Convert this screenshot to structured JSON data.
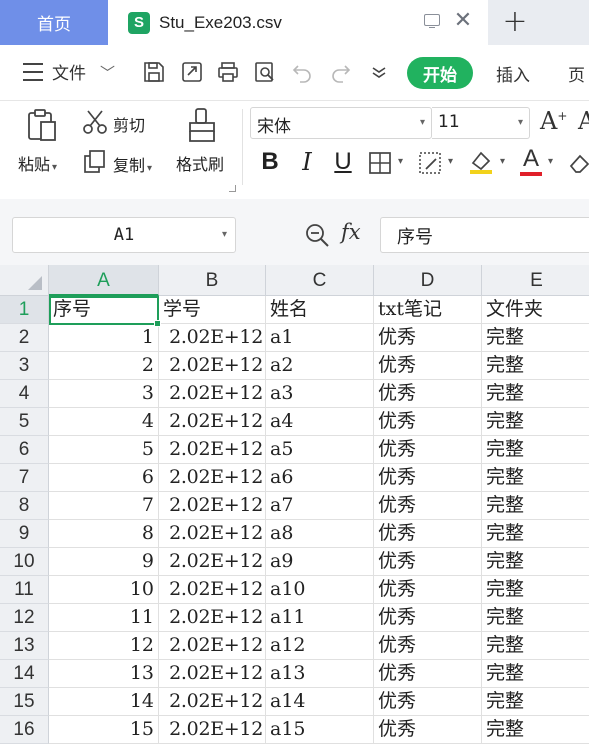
{
  "tabs": {
    "home_label": "首页",
    "file_logo": "S",
    "file_name": "Stu_Exe203.csv",
    "close_glyph": "✕",
    "add_glyph": "+"
  },
  "menu": {
    "file_label": "文件",
    "file_caret": "﹀",
    "start_label": "开始",
    "insert_label": "插入",
    "page_label": "页"
  },
  "ribbon": {
    "paste_label": "粘贴",
    "cut_label": "剪切",
    "copy_label": "复制",
    "format_painter_label": "格式刷",
    "font_name": "宋体",
    "font_size": "11",
    "bold_glyph": "B",
    "italic_glyph": "I",
    "underline_glyph": "U",
    "font_color_glyph": "A",
    "font_color": "#e0202a",
    "highlight_color": "#f2d21b",
    "grow_font_glyph": "A",
    "caret": "▾"
  },
  "formula_bar": {
    "name_box": "A1",
    "fx_label": "fx",
    "formula_value": "序号"
  },
  "sheet": {
    "columns": [
      "A",
      "B",
      "C",
      "D",
      "E"
    ],
    "header_row": [
      "序号",
      "学号",
      "姓名",
      "txt笔记",
      "文件夹"
    ],
    "rows": [
      {
        "row_num": "1"
      },
      {
        "row_num": "2",
        "a": "1",
        "b": "2.02E+12",
        "c": "a1",
        "d": "优秀",
        "e": "完整"
      },
      {
        "row_num": "3",
        "a": "2",
        "b": "2.02E+12",
        "c": "a2",
        "d": "优秀",
        "e": "完整"
      },
      {
        "row_num": "4",
        "a": "3",
        "b": "2.02E+12",
        "c": "a3",
        "d": "优秀",
        "e": "完整"
      },
      {
        "row_num": "5",
        "a": "4",
        "b": "2.02E+12",
        "c": "a4",
        "d": "优秀",
        "e": "完整"
      },
      {
        "row_num": "6",
        "a": "5",
        "b": "2.02E+12",
        "c": "a5",
        "d": "优秀",
        "e": "完整"
      },
      {
        "row_num": "7",
        "a": "6",
        "b": "2.02E+12",
        "c": "a6",
        "d": "优秀",
        "e": "完整"
      },
      {
        "row_num": "8",
        "a": "7",
        "b": "2.02E+12",
        "c": "a7",
        "d": "优秀",
        "e": "完整"
      },
      {
        "row_num": "9",
        "a": "8",
        "b": "2.02E+12",
        "c": "a8",
        "d": "优秀",
        "e": "完整"
      },
      {
        "row_num": "10",
        "a": "9",
        "b": "2.02E+12",
        "c": "a9",
        "d": "优秀",
        "e": "完整"
      },
      {
        "row_num": "11",
        "a": "10",
        "b": "2.02E+12",
        "c": "a10",
        "d": "优秀",
        "e": "完整"
      },
      {
        "row_num": "12",
        "a": "11",
        "b": "2.02E+12",
        "c": "a11",
        "d": "优秀",
        "e": "完整"
      },
      {
        "row_num": "13",
        "a": "12",
        "b": "2.02E+12",
        "c": "a12",
        "d": "优秀",
        "e": "完整"
      },
      {
        "row_num": "14",
        "a": "13",
        "b": "2.02E+12",
        "c": "a13",
        "d": "优秀",
        "e": "完整"
      },
      {
        "row_num": "15",
        "a": "14",
        "b": "2.02E+12",
        "c": "a14",
        "d": "优秀",
        "e": "完整"
      },
      {
        "row_num": "16",
        "a": "15",
        "b": "2.02E+12",
        "c": "a15",
        "d": "优秀",
        "e": "完整"
      }
    ]
  },
  "colors": {
    "home_tab": "#6f8fe8",
    "start_button": "#21b25f",
    "selection": "#1e9e5a",
    "file_logo": "#1fa463"
  }
}
